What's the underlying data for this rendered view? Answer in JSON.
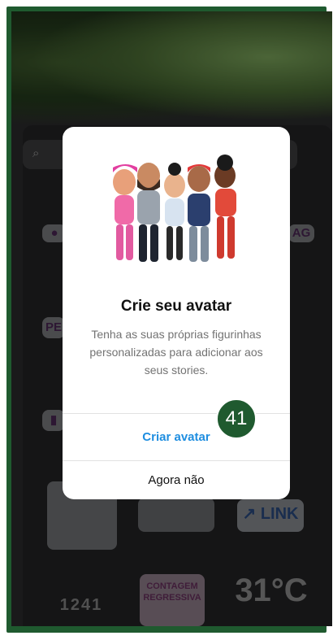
{
  "search": {
    "icon": "search-icon"
  },
  "stickers": {
    "location": "●",
    "pe": "PE",
    "tag": "AG",
    "music": "▮",
    "link": "↗ LINK",
    "temperature": "31°C",
    "countdown": "CONTAGEM REGRESSIVA",
    "digits": "1241"
  },
  "modal": {
    "title": "Crie seu avatar",
    "body": "Tenha as suas próprias figurinhas personalizadas para adicionar aos seus stories.",
    "primary_label": "Criar avatar",
    "secondary_label": "Agora não"
  },
  "annotation": {
    "badge": "41"
  },
  "colors": {
    "accent": "#1f8ee0",
    "frame": "#1f5a2f"
  }
}
